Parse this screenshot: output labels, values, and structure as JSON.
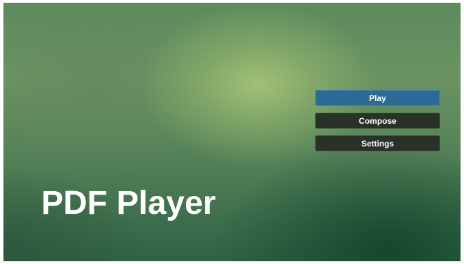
{
  "app": {
    "title": "PDF Player"
  },
  "menu": {
    "items": [
      {
        "label": "Play",
        "state": "selected"
      },
      {
        "label": "Compose",
        "state": "normal"
      },
      {
        "label": "Settings",
        "state": "normal"
      }
    ]
  },
  "colors": {
    "selected_button": "#2d6b96",
    "normal_button": "#2a3127",
    "background_accent": "#6b9362"
  }
}
